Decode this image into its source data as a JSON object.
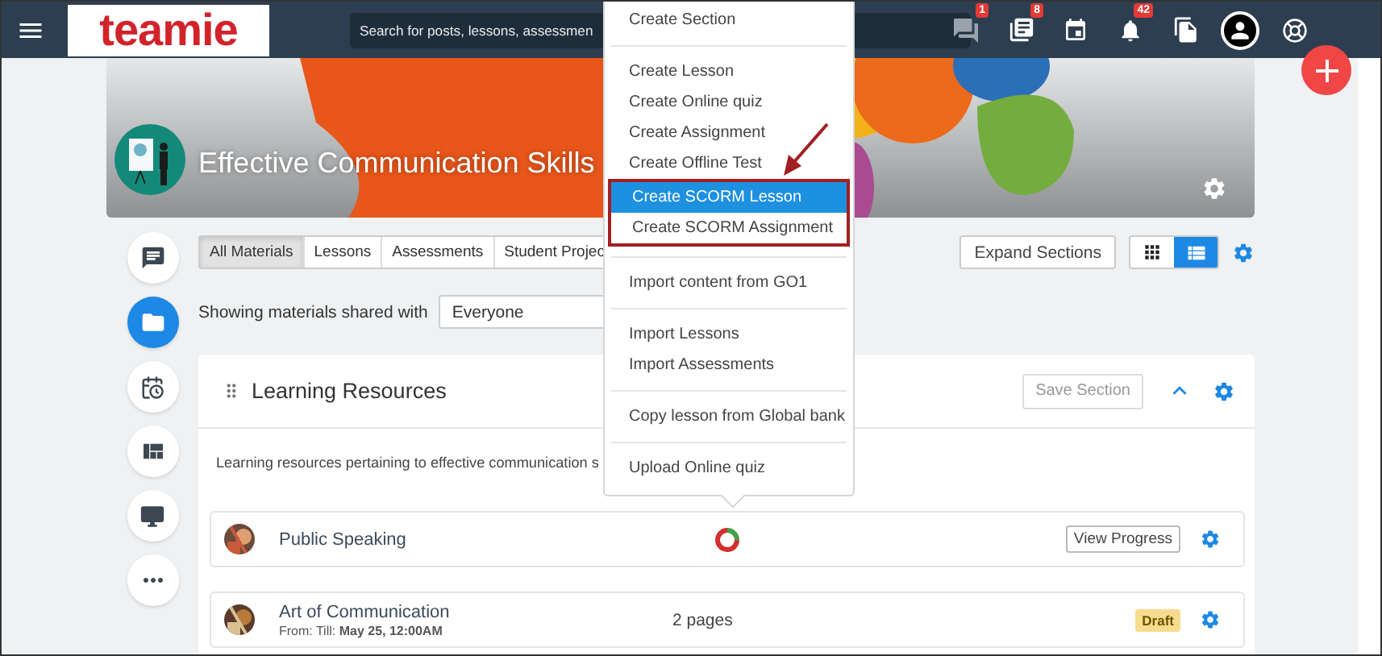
{
  "top_bar": {
    "logo": "teamie",
    "search": {
      "placeholder": "Search for posts, lessons, assessmen"
    },
    "icons": [
      {
        "kind": "chat",
        "badge": "1"
      },
      {
        "kind": "books",
        "badge": "8"
      },
      {
        "kind": "calendar"
      },
      {
        "kind": "bell",
        "badge": "42"
      },
      {
        "kind": "files"
      },
      {
        "kind": "avatar"
      },
      {
        "kind": "help"
      }
    ]
  },
  "banner": {
    "title": "Effective Communication Skills"
  },
  "rail": [
    {
      "kind": "chat",
      "selected": false
    },
    {
      "kind": "folder",
      "selected": true
    },
    {
      "kind": "calendar",
      "selected": false
    },
    {
      "kind": "dashboard",
      "selected": false
    },
    {
      "kind": "monitor",
      "selected": false
    },
    {
      "kind": "more",
      "selected": false
    }
  ],
  "tabs": [
    {
      "label": "All Materials",
      "selected": true
    },
    {
      "label": "Lessons",
      "selected": false
    },
    {
      "label": "Assessments",
      "selected": false
    },
    {
      "label": "Student Projec",
      "selected": false
    }
  ],
  "filter": {
    "label": "Showing materials shared with",
    "value": "Everyone"
  },
  "expand_button": "Expand Sections",
  "view_modes": [
    {
      "kind": "grid",
      "selected": false
    },
    {
      "kind": "list",
      "selected": true
    }
  ],
  "section": {
    "title": "Learning Resources",
    "save_button": "Save Section",
    "description": "Learning resources pertaining to effective communication s",
    "items": [
      {
        "kind": "progress",
        "title": "Public Speaking",
        "level": 0.25,
        "button": "View Progress"
      },
      {
        "kind": "pages",
        "title": "Art of Communication",
        "meta": "From: Till: **May 25, 12:00AM**",
        "pages": "2 pages",
        "badge": "Draft"
      }
    ]
  },
  "menu": {
    "groups": [
      {
        "kind": "plain",
        "items": [
          {
            "label": "Create Section",
            "selected": false
          }
        ]
      },
      {
        "kind": "plain",
        "items": [
          {
            "label": "Create Lesson",
            "selected": false
          },
          {
            "label": "Create Online quiz",
            "selected": false
          },
          {
            "label": "Create Assignment",
            "selected": false
          },
          {
            "label": "Create Offline Test",
            "selected": false
          }
        ]
      },
      {
        "kind": "callout",
        "items": [
          {
            "label": "Create SCORM Lesson",
            "selected": true
          },
          {
            "label": "Create SCORM Assignment",
            "selected": false
          }
        ]
      },
      {
        "kind": "plain",
        "items": [
          {
            "label": "Import content from GO1",
            "selected": false
          }
        ]
      },
      {
        "kind": "plain",
        "items": [
          {
            "label": "Import Lessons",
            "selected": false
          },
          {
            "label": "Import Assessments",
            "selected": false
          }
        ]
      },
      {
        "kind": "plain",
        "items": [
          {
            "label": "Copy lesson from Global bank",
            "selected": false
          }
        ]
      },
      {
        "kind": "plain",
        "items": [
          {
            "label": "Upload Online quiz",
            "selected": false
          }
        ]
      }
    ]
  }
}
